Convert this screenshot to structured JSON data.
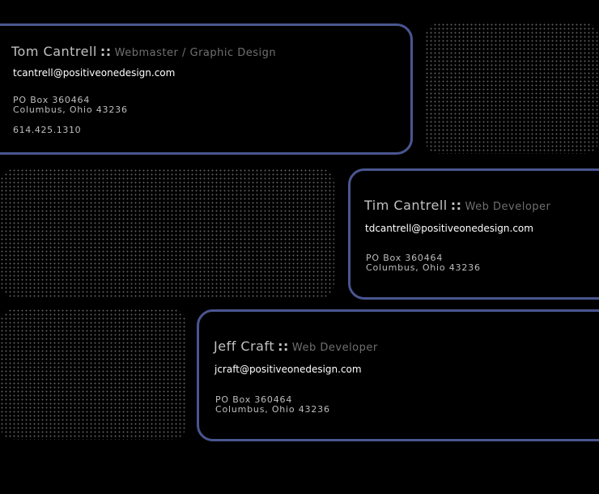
{
  "cards": [
    {
      "name": "Tom Cantrell",
      "separator": "::",
      "role": "Webmaster / Graphic Design",
      "email": "tcantrell@positiveonedesign.com",
      "address_line1": "PO Box 360464",
      "address_line2": "Columbus, Ohio 43236",
      "phone": "614.425.1310"
    },
    {
      "name": "Tim Cantrell",
      "separator": "::",
      "role": "Web Developer",
      "email": "tdcantrell@positiveonedesign.com",
      "address_line1": "PO Box 360464",
      "address_line2": "Columbus, Ohio 43236"
    },
    {
      "name": "Jeff Craft",
      "separator": "::",
      "role": "Web Developer",
      "email": "jcraft@positiveonedesign.com",
      "address_line1": "PO Box 360464",
      "address_line2": "Columbus, Ohio 43236"
    }
  ],
  "colors": {
    "background": "#000000",
    "card_border": "#4a5690",
    "dot_pattern": "#5e5e5e",
    "name_text": "#c2c2c2",
    "role_text": "#6f6f6f",
    "email_text": "#ffffff"
  }
}
